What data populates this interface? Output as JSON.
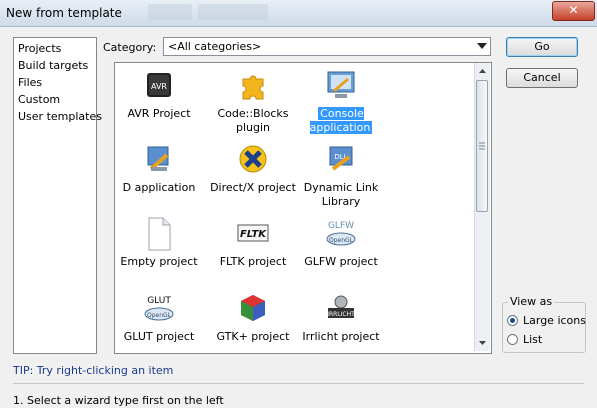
{
  "window": {
    "title": "New from template",
    "close_glyph": "✕"
  },
  "sidebar": {
    "items": [
      "Projects",
      "Build targets",
      "Files",
      "Custom",
      "User templates"
    ]
  },
  "category": {
    "label": "Category:",
    "value": "<All categories>"
  },
  "templates": [
    {
      "label": "AVR Project",
      "icon": "avr-chip-icon",
      "selected": false
    },
    {
      "label": "Code::Blocks plugin",
      "icon": "puzzle-plugin-icon",
      "selected": false
    },
    {
      "label": "Console application",
      "icon": "console-monitor-icon",
      "selected": true
    },
    {
      "label": "D application",
      "icon": "d-application-icon",
      "selected": false
    },
    {
      "label": "Direct/X project",
      "icon": "directx-icon",
      "selected": false
    },
    {
      "label": "Dynamic Link Library",
      "icon": "dll-icon",
      "selected": false
    },
    {
      "label": "Empty project",
      "icon": "blank-page-icon",
      "selected": false
    },
    {
      "label": "FLTK project",
      "icon": "fltk-icon",
      "selected": false
    },
    {
      "label": "GLFW project",
      "icon": "glfw-opengl-icon",
      "selected": false
    },
    {
      "label": "GLUT project",
      "icon": "glut-opengl-icon",
      "selected": false
    },
    {
      "label": "GTK+ project",
      "icon": "gtk-cube-icon",
      "selected": false
    },
    {
      "label": "Irrlicht project",
      "icon": "irrlicht-icon",
      "selected": false
    }
  ],
  "icon_text": {
    "avr": "AVR",
    "dll": "DLL",
    "fltk": "FLTK",
    "glfw": "GLFW",
    "glut": "GLUT",
    "opengl": "OpenGL",
    "irrlicht": "IRRLICHT"
  },
  "buttons": {
    "go": "Go",
    "cancel": "Cancel"
  },
  "view_as": {
    "legend": "View as",
    "options": [
      {
        "label": "Large icons",
        "checked": true
      },
      {
        "label": "List",
        "checked": false
      }
    ]
  },
  "tip": "TIP: Try right-clicking an item",
  "wizard_step": "1. Select a wizard type first on the left",
  "colors": {
    "selection": "#3399ff",
    "tip_text": "#1a3a8a"
  }
}
